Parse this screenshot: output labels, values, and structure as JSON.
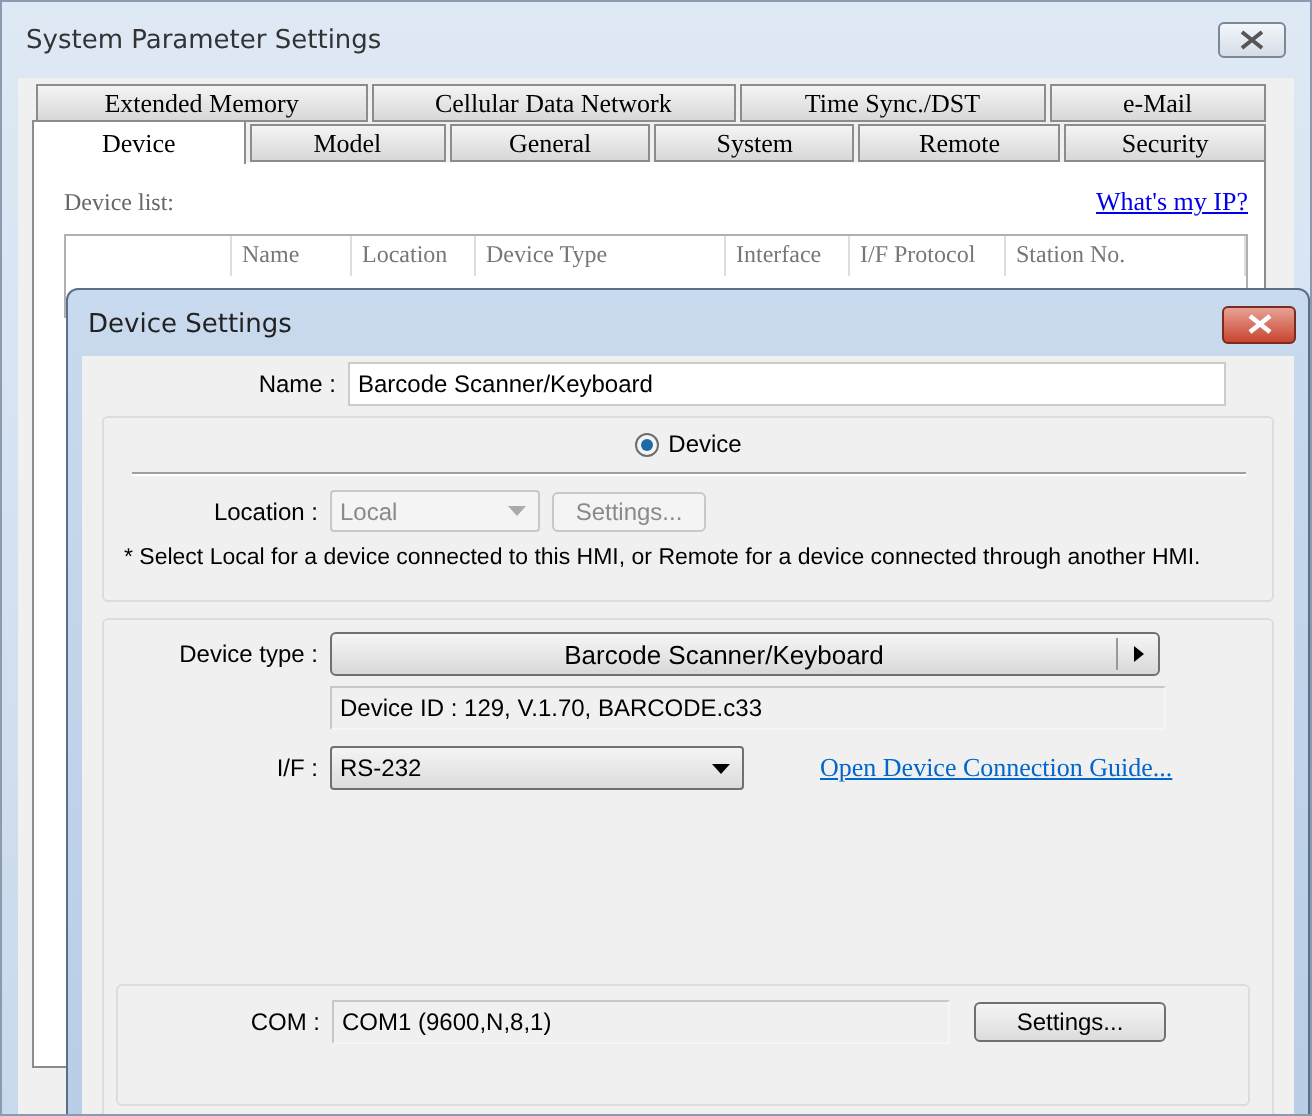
{
  "window": {
    "title": "System Parameter Settings"
  },
  "tabs": {
    "back_row": [
      {
        "label": "Extended Memory",
        "selected": false
      },
      {
        "label": "Cellular Data Network",
        "selected": false
      },
      {
        "label": "Time Sync./DST",
        "selected": false
      },
      {
        "label": "e-Mail",
        "selected": false
      }
    ],
    "front_row": [
      {
        "label": "Device",
        "selected": true
      },
      {
        "label": "Model",
        "selected": false
      },
      {
        "label": "General",
        "selected": false
      },
      {
        "label": "System",
        "selected": false
      },
      {
        "label": "Remote",
        "selected": false
      },
      {
        "label": "Security",
        "selected": false
      }
    ]
  },
  "device_list": {
    "label": "Device list:",
    "link": "What's my IP?",
    "columns": [
      "Name",
      "Location",
      "Device Type",
      "Interface",
      "I/F Protocol",
      "Station No."
    ]
  },
  "dialog": {
    "title": "Device Settings",
    "name": {
      "label": "Name :",
      "value": "Barcode Scanner/Keyboard"
    },
    "radio": {
      "label": "Device",
      "selected": true
    },
    "location": {
      "label": "Location :",
      "value": "Local",
      "disabled": true,
      "button": "Settings..."
    },
    "note": "* Select Local for a device connected to this HMI, or Remote for a device connected through another HMI.",
    "device_type": {
      "label": "Device type :",
      "value": "Barcode Scanner/Keyboard",
      "info": "Device ID : 129, V.1.70, BARCODE.c33"
    },
    "interface": {
      "label": "I/F :",
      "value": "RS-232",
      "link": "Open Device Connection Guide..."
    },
    "com": {
      "label": "COM :",
      "value": "COM1 (9600,N,8,1)",
      "button": "Settings..."
    }
  }
}
